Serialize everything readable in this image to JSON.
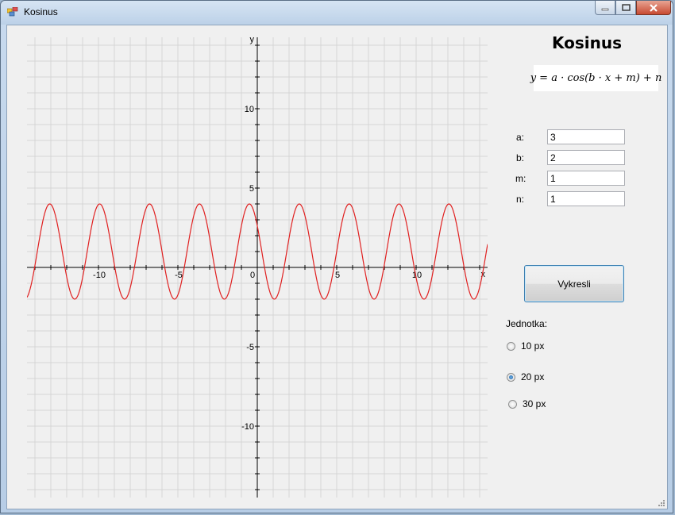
{
  "window": {
    "title": "Kosinus",
    "controls": {
      "minimize": "minimize",
      "maximize": "maximize",
      "close": "close"
    }
  },
  "form": {
    "heading": "Kosinus",
    "formula": "y = a · cos(b · x + m) + n",
    "params": [
      {
        "label": "a:",
        "value": "3"
      },
      {
        "label": "b:",
        "value": "2"
      },
      {
        "label": "m:",
        "value": "1"
      },
      {
        "label": "n:",
        "value": "1"
      }
    ],
    "draw_button": "Vykresli",
    "unit_label": "Jednotka:",
    "units": [
      {
        "label": "10 px",
        "selected": false
      },
      {
        "label": "20 px",
        "selected": true
      },
      {
        "label": "30 px",
        "selected": false
      }
    ]
  },
  "chart_data": {
    "type": "line",
    "xlabel": "x",
    "ylabel": "y",
    "xlim": [
      -14.5,
      14.5
    ],
    "ylim": [
      -14.5,
      14.5
    ],
    "grid": true,
    "x_ticks": [
      "-10",
      "-5",
      "0",
      "5",
      "10"
    ],
    "y_ticks": [
      "10",
      "5",
      "-5",
      "-10"
    ],
    "tick_values_x": [
      -10,
      -5,
      0,
      5,
      10
    ],
    "tick_values_y": [
      10,
      5,
      -5,
      -10
    ],
    "function": {
      "a": 3,
      "b": 2,
      "m": 1,
      "n": 1
    },
    "color": "#e02020"
  }
}
